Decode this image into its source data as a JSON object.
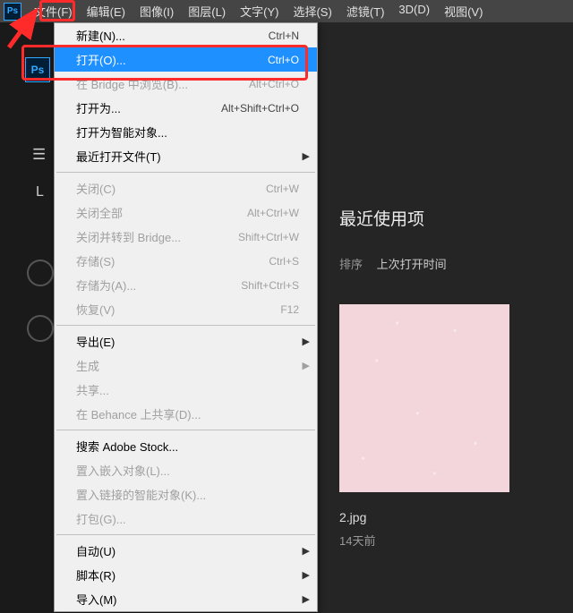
{
  "menubar": {
    "items": [
      {
        "label": "文件(F)"
      },
      {
        "label": "编辑(E)"
      },
      {
        "label": "图像(I)"
      },
      {
        "label": "图层(L)"
      },
      {
        "label": "文字(Y)"
      },
      {
        "label": "选择(S)"
      },
      {
        "label": "滤镜(T)"
      },
      {
        "label": "3D(D)"
      },
      {
        "label": "视图(V)"
      }
    ]
  },
  "dropdown": {
    "groups": [
      [
        {
          "label": "新建(N)...",
          "shortcut": "Ctrl+N"
        },
        {
          "label": "打开(O)...",
          "shortcut": "Ctrl+O",
          "highlighted": true
        },
        {
          "label": "在 Bridge 中浏览(B)...",
          "shortcut": "Alt+Ctrl+O",
          "disabled": true
        },
        {
          "label": "打开为...",
          "shortcut": "Alt+Shift+Ctrl+O"
        },
        {
          "label": "打开为智能对象..."
        },
        {
          "label": "最近打开文件(T)",
          "submenu": true
        }
      ],
      [
        {
          "label": "关闭(C)",
          "shortcut": "Ctrl+W",
          "disabled": true
        },
        {
          "label": "关闭全部",
          "shortcut": "Alt+Ctrl+W",
          "disabled": true
        },
        {
          "label": "关闭并转到 Bridge...",
          "shortcut": "Shift+Ctrl+W",
          "disabled": true
        },
        {
          "label": "存储(S)",
          "shortcut": "Ctrl+S",
          "disabled": true
        },
        {
          "label": "存储为(A)...",
          "shortcut": "Shift+Ctrl+S",
          "disabled": true
        },
        {
          "label": "恢复(V)",
          "shortcut": "F12",
          "disabled": true
        }
      ],
      [
        {
          "label": "导出(E)",
          "submenu": true
        },
        {
          "label": "生成",
          "submenu": true,
          "disabled": true
        },
        {
          "label": "共享...",
          "disabled": true
        },
        {
          "label": "在 Behance 上共享(D)...",
          "disabled": true
        }
      ],
      [
        {
          "label": "搜索 Adobe Stock..."
        },
        {
          "label": "置入嵌入对象(L)...",
          "disabled": true
        },
        {
          "label": "置入链接的智能对象(K)...",
          "disabled": true
        },
        {
          "label": "打包(G)...",
          "disabled": true
        }
      ],
      [
        {
          "label": "自动(U)",
          "submenu": true
        },
        {
          "label": "脚本(R)",
          "submenu": true
        },
        {
          "label": "导入(M)",
          "submenu": true
        }
      ]
    ]
  },
  "panel": {
    "recent_title": "最近使用项",
    "sort_label": "排序",
    "sort_value": "上次打开时间",
    "thumb_name": "2.jpg",
    "thumb_ago": "14天前"
  },
  "logo": "Ps"
}
